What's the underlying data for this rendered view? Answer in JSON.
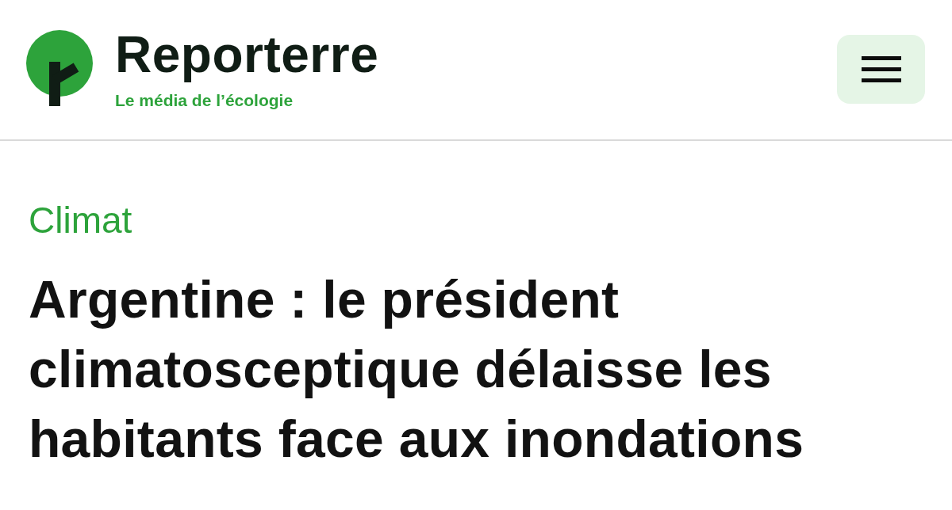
{
  "header": {
    "brand": {
      "name": "Reporterre",
      "tagline": "Le média de l’écologie"
    }
  },
  "article": {
    "category": "Climat",
    "headline": "Argentine : le président climatosceptique délaisse les habitants face aux inondations"
  }
}
